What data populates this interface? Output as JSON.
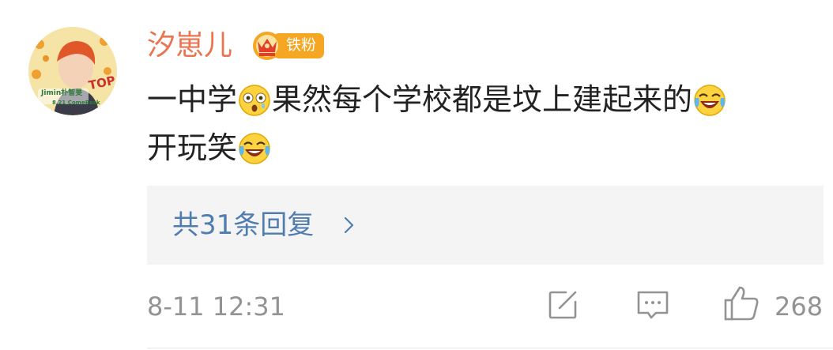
{
  "comment": {
    "username": "汐崽儿",
    "fan_badge": "铁粉",
    "avatar": {
      "text_name": "Jimin朴智旻",
      "text_top": "TOP",
      "text_sub": "8.21 ComeBack"
    },
    "body": {
      "segment_1": "一中学",
      "emoji_1": "shocked-face-emoji",
      "segment_2": "果然每个学校都是坟上建起来的",
      "emoji_2": "laugh-cry-emoji",
      "segment_3": "开玩笑",
      "emoji_3": "laugh-cry-emoji"
    },
    "replies_label": "共31条回复",
    "timestamp": "8-11 12:31",
    "like_count": "268"
  },
  "colors": {
    "username": "#eb7350",
    "link": "#507daf",
    "meta": "#939393",
    "reply_bg": "#f4f4f4",
    "badge_orange": "#f5a623"
  },
  "icons": [
    "share-icon",
    "comment-icon",
    "like-icon",
    "chevron-right-icon",
    "crown-badge-icon"
  ]
}
